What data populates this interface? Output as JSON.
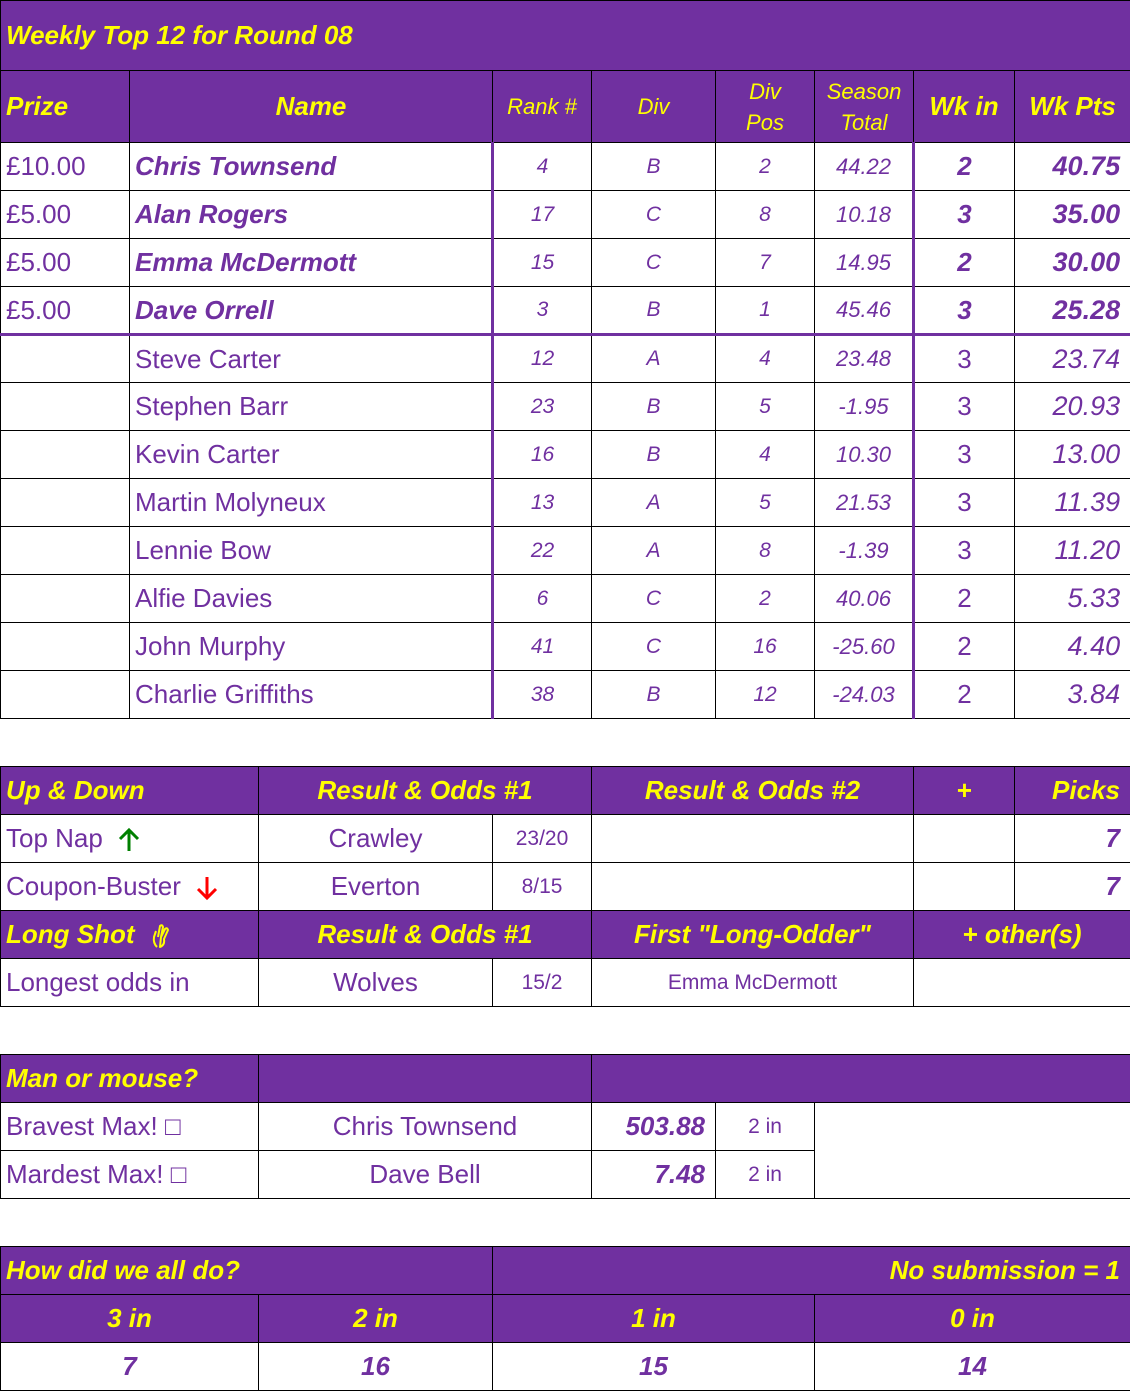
{
  "weekly": {
    "title": "Weekly Top 12 for Round 08",
    "headers": {
      "prize": "Prize",
      "name": "Name",
      "rank": "Rank #",
      "div": "Div",
      "divpos_1": "Div",
      "divpos_2": "Pos",
      "season_1": "Season",
      "season_2": "Total",
      "wkin": "Wk in",
      "wkpts": "Wk Pts"
    },
    "rows": [
      {
        "prize": "£10.00",
        "name": "Chris Townsend",
        "rank": "4",
        "div": "B",
        "divpos": "2",
        "season": "44.22",
        "wkin": "2",
        "wkpts": "40.75"
      },
      {
        "prize": "£5.00",
        "name": "Alan Rogers",
        "rank": "17",
        "div": "C",
        "divpos": "8",
        "season": "10.18",
        "wkin": "3",
        "wkpts": "35.00"
      },
      {
        "prize": "£5.00",
        "name": "Emma McDermott",
        "rank": "15",
        "div": "C",
        "divpos": "7",
        "season": "14.95",
        "wkin": "2",
        "wkpts": "30.00"
      },
      {
        "prize": "£5.00",
        "name": "Dave Orrell",
        "rank": "3",
        "div": "B",
        "divpos": "1",
        "season": "45.46",
        "wkin": "3",
        "wkpts": "25.28"
      },
      {
        "prize": "",
        "name": "Steve Carter",
        "rank": "12",
        "div": "A",
        "divpos": "4",
        "season": "23.48",
        "wkin": "3",
        "wkpts": "23.74"
      },
      {
        "prize": "",
        "name": "Stephen Barr",
        "rank": "23",
        "div": "B",
        "divpos": "5",
        "season": "-1.95",
        "wkin": "3",
        "wkpts": "20.93"
      },
      {
        "prize": "",
        "name": "Kevin Carter",
        "rank": "16",
        "div": "B",
        "divpos": "4",
        "season": "10.30",
        "wkin": "3",
        "wkpts": "13.00"
      },
      {
        "prize": "",
        "name": "Martin Molyneux",
        "rank": "13",
        "div": "A",
        "divpos": "5",
        "season": "21.53",
        "wkin": "3",
        "wkpts": "11.39"
      },
      {
        "prize": "",
        "name": "Lennie Bow",
        "rank": "22",
        "div": "A",
        "divpos": "8",
        "season": "-1.39",
        "wkin": "3",
        "wkpts": "11.20"
      },
      {
        "prize": "",
        "name": "Alfie Davies",
        "rank": "6",
        "div": "C",
        "divpos": "2",
        "season": "40.06",
        "wkin": "2",
        "wkpts": "5.33"
      },
      {
        "prize": "",
        "name": "John Murphy",
        "rank": "41",
        "div": "C",
        "divpos": "16",
        "season": "-25.60",
        "wkin": "2",
        "wkpts": "4.40"
      },
      {
        "prize": "",
        "name": "Charlie Griffiths",
        "rank": "38",
        "div": "B",
        "divpos": "12",
        "season": "-24.03",
        "wkin": "2",
        "wkpts": "3.84"
      }
    ]
  },
  "updown": {
    "header": {
      "label": "Up & Down",
      "result1": "Result & Odds #1",
      "result2": "Result & Odds #2",
      "plus": "+",
      "picks": "Picks"
    },
    "top_nap": {
      "label": "Top Nap",
      "icon": "up-arrow-icon",
      "icon_color": "#008000",
      "team": "Crawley",
      "odds": "23/20",
      "picks": "7"
    },
    "coupon_buster": {
      "label": "Coupon-Buster",
      "icon": "down-arrow-icon",
      "icon_color": "#ff0000",
      "team": "Everton",
      "odds": "8/15",
      "picks": "7"
    },
    "long_shot_header": {
      "label": "Long Shot",
      "icon": "crossed-fingers-icon",
      "result1": "Result & Odds #1",
      "first": "First \"Long-Odder\"",
      "others": "+ other(s)"
    },
    "longest": {
      "label": "Longest odds in",
      "team": "Wolves",
      "odds": "15/2",
      "first": "Emma McDermott"
    }
  },
  "manmouse": {
    "header": "Man or mouse?",
    "bravest": {
      "label": "Bravest Max!",
      "icon": "box-icon",
      "glyph": "□",
      "name": "Chris Townsend",
      "value": "503.88",
      "in": "2 in"
    },
    "mardest": {
      "label": "Mardest Max!",
      "icon": "box-icon",
      "glyph": "□",
      "name": "Dave Bell",
      "value": "7.48",
      "in": "2 in"
    }
  },
  "howdid": {
    "title": "How did we all do?",
    "nosub": "No submission = 1",
    "cols": [
      "3 in",
      "2 in",
      "1 in",
      "0 in"
    ],
    "values": [
      "7",
      "16",
      "15",
      "14"
    ]
  },
  "colors": {
    "header_bg": "#7030a0",
    "header_text": "#ffff00",
    "body_text": "#7030a0"
  }
}
